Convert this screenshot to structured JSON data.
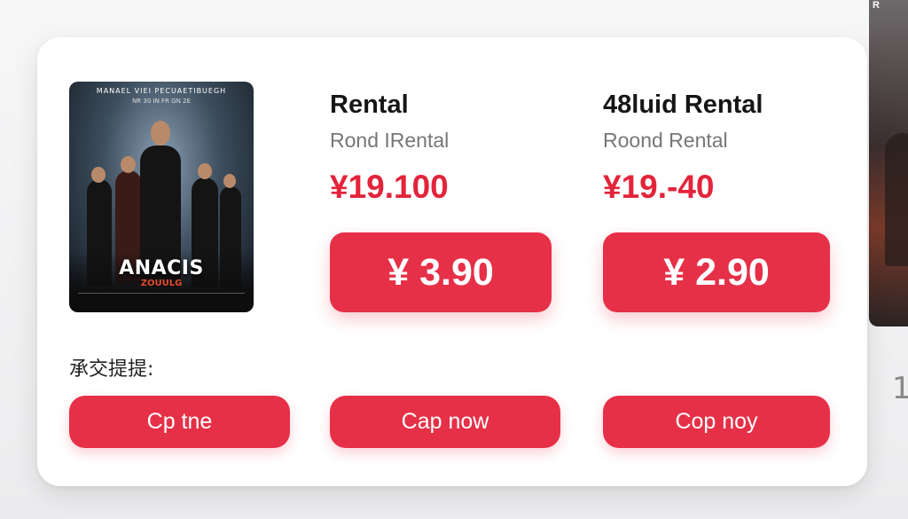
{
  "side": {
    "label": "1",
    "poster_tag": "R"
  },
  "movie": {
    "poster_top": "MANAEL VIEI PECUAETIBUEGH",
    "poster_sub": "NR 30 IN  FR GN 2E",
    "poster_title": "ANACIS",
    "poster_subtitle": "ZOUULG"
  },
  "plans": [
    {
      "title": "Rental",
      "subtitle": "Rond IRental",
      "price": "¥19.100",
      "button": "¥ 3.90",
      "action": "Cap now"
    },
    {
      "title": "48luid Rental",
      "subtitle": "Roond Rental",
      "price": "¥19.-40",
      "button": "¥ 2.90",
      "action": "Cop noy"
    }
  ],
  "note_label": "承交提提:",
  "left_action": "Cp tne",
  "colors": {
    "accent": "#e63047",
    "price_text": "#e3243b"
  }
}
